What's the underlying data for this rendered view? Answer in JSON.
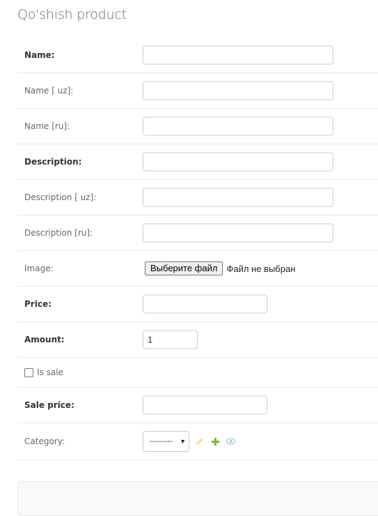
{
  "page_title": "Qo'shish product",
  "fields": {
    "name": {
      "label": "Name:",
      "value": ""
    },
    "name_uz": {
      "label": "Name [ uz]:",
      "value": ""
    },
    "name_ru": {
      "label": "Name [ru]:",
      "value": ""
    },
    "description": {
      "label": "Description:",
      "value": ""
    },
    "description_uz": {
      "label": "Description [ uz]:",
      "value": ""
    },
    "description_ru": {
      "label": "Description [ru]:",
      "value": ""
    },
    "image": {
      "label": "Image:",
      "button_label": "Выберите файл",
      "status": "Файл не выбран"
    },
    "price": {
      "label": "Price:",
      "value": ""
    },
    "amount": {
      "label": "Amount:",
      "value": "1"
    },
    "is_sale": {
      "label": "Is sale",
      "checked": false
    },
    "sale_price": {
      "label": "Sale price:",
      "value": ""
    },
    "category": {
      "label": "Category:",
      "selected": "---------",
      "icons": [
        "pencil-icon",
        "plus-icon",
        "eye-icon"
      ]
    }
  },
  "colors": {
    "required_label": "#333333",
    "optional_label": "#666666",
    "pencil": "#efb80b",
    "plus": "#70bf2b",
    "eye": "#79aec8"
  }
}
